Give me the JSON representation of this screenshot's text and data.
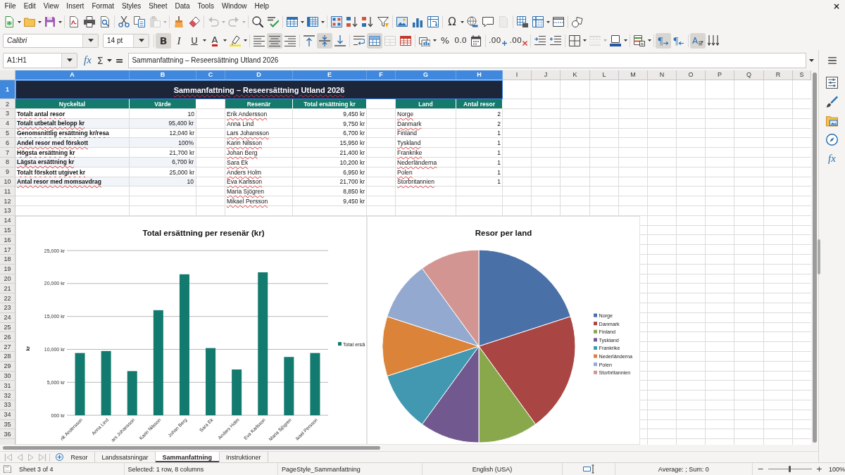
{
  "menu_bar": {
    "items": [
      "File",
      "Edit",
      "View",
      "Insert",
      "Format",
      "Styles",
      "Sheet",
      "Data",
      "Tools",
      "Window",
      "Help"
    ],
    "close": "×"
  },
  "standard_toolbar": [
    [
      {
        "kind": "new",
        "dropdown": true,
        "disabled": false
      },
      {
        "kind": "open",
        "dropdown": true,
        "disabled": false
      },
      {
        "kind": "save",
        "dropdown": true,
        "disabled": false
      }
    ],
    [
      {
        "kind": "export-pdf",
        "dropdown": false,
        "disabled": false
      },
      {
        "kind": "print",
        "dropdown": false,
        "disabled": false
      },
      {
        "kind": "print-preview",
        "dropdown": false,
        "disabled": false
      }
    ],
    [
      {
        "kind": "cut",
        "dropdown": false,
        "disabled": false
      },
      {
        "kind": "copy",
        "dropdown": false,
        "disabled": false
      },
      {
        "kind": "paste",
        "dropdown": true,
        "disabled": true
      }
    ],
    [
      {
        "kind": "clone-formatting",
        "dropdown": false,
        "disabled": false
      },
      {
        "kind": "clear-formatting",
        "dropdown": false,
        "disabled": false
      }
    ],
    [
      {
        "kind": "undo",
        "dropdown": true,
        "disabled": true
      },
      {
        "kind": "redo",
        "dropdown": true,
        "disabled": true
      }
    ],
    [
      {
        "kind": "find-replace",
        "dropdown": false,
        "disabled": false
      },
      {
        "kind": "spelling",
        "dropdown": false,
        "disabled": false
      }
    ],
    [
      {
        "kind": "row",
        "dropdown": true,
        "disabled": false
      },
      {
        "kind": "column",
        "dropdown": true,
        "disabled": false
      }
    ],
    [
      {
        "kind": "sort",
        "dropdown": false,
        "disabled": false
      },
      {
        "kind": "sort-ascending",
        "dropdown": false,
        "disabled": false
      },
      {
        "kind": "sort-descending",
        "dropdown": false,
        "disabled": false
      },
      {
        "kind": "autofilter",
        "dropdown": false,
        "disabled": false
      }
    ],
    [
      {
        "kind": "image",
        "dropdown": false,
        "disabled": false
      },
      {
        "kind": "chart",
        "dropdown": false,
        "disabled": false
      },
      {
        "kind": "pivot-table",
        "dropdown": false,
        "disabled": false
      }
    ],
    [
      {
        "kind": "special-character",
        "glyph": "Ω",
        "dropdown": true,
        "disabled": false
      },
      {
        "kind": "hyperlink",
        "dropdown": false,
        "disabled": false
      },
      {
        "kind": "comment",
        "dropdown": false,
        "disabled": false
      },
      {
        "kind": "headers-footers",
        "dropdown": false,
        "disabled": true
      }
    ],
    [
      {
        "kind": "print-area",
        "dropdown": false,
        "disabled": false
      },
      {
        "kind": "freeze",
        "dropdown": true,
        "disabled": false
      },
      {
        "kind": "split-window",
        "dropdown": false,
        "disabled": false
      }
    ],
    [
      {
        "kind": "draw-functions",
        "dropdown": false,
        "disabled": false
      }
    ]
  ],
  "formatting_toolbar": {
    "font_name": "Calibri",
    "font_size": "14 pt",
    "groups": [
      [
        {
          "kind": "bold",
          "glyph": "B",
          "dropdown": false,
          "on": true,
          "disabled": false
        },
        {
          "kind": "italic",
          "glyph": "I",
          "dropdown": false,
          "on": false,
          "disabled": false
        },
        {
          "kind": "underline",
          "glyph": "U",
          "dropdown": true,
          "on": false,
          "disabled": false
        },
        {
          "kind": "font-color",
          "glyph": "A",
          "dropdown": true,
          "on": false,
          "disabled": false
        },
        {
          "kind": "highlight",
          "dropdown": true,
          "on": false,
          "disabled": false
        }
      ],
      [
        {
          "kind": "align-left",
          "dropdown": false,
          "on": false,
          "disabled": false
        },
        {
          "kind": "align-center",
          "dropdown": false,
          "on": true,
          "disabled": false
        },
        {
          "kind": "align-right",
          "dropdown": false,
          "on": false,
          "disabled": false
        }
      ],
      [
        {
          "kind": "align-top",
          "dropdown": false,
          "on": false,
          "disabled": false
        },
        {
          "kind": "align-middle",
          "dropdown": false,
          "on": true,
          "disabled": false
        },
        {
          "kind": "align-bottom",
          "dropdown": false,
          "on": false,
          "disabled": false
        }
      ],
      [
        {
          "kind": "wrap",
          "dropdown": false,
          "on": false,
          "disabled": false
        },
        {
          "kind": "merge-center",
          "dropdown": false,
          "on": true,
          "disabled": false
        },
        {
          "kind": "merge",
          "dropdown": false,
          "on": false,
          "disabled": true
        },
        {
          "kind": "unmerge",
          "dropdown": false,
          "on": false,
          "disabled": false
        }
      ],
      [
        {
          "kind": "currency-format",
          "dropdown": true,
          "on": false,
          "disabled": false
        },
        {
          "kind": "percent",
          "glyph": "%",
          "dropdown": false,
          "on": false,
          "disabled": false
        },
        {
          "kind": "standard-format",
          "glyph": "0.0",
          "dropdown": false,
          "on": false,
          "disabled": false
        },
        {
          "kind": "date-format",
          "dropdown": false,
          "on": false,
          "disabled": false
        }
      ],
      [
        {
          "kind": "add-decimal",
          "glyph": ".00",
          "dropdown": false,
          "on": false,
          "disabled": false
        },
        {
          "kind": "delete-decimal",
          "glyph": ".00",
          "dropdown": false,
          "on": false,
          "disabled": false
        }
      ],
      [
        {
          "kind": "indent-increase",
          "dropdown": false,
          "on": false,
          "disabled": false
        },
        {
          "kind": "indent-decrease",
          "dropdown": false,
          "on": false,
          "disabled": false
        }
      ],
      [
        {
          "kind": "borders",
          "dropdown": true,
          "on": false,
          "disabled": false
        },
        {
          "kind": "border-style",
          "dropdown": true,
          "on": false,
          "disabled": true
        },
        {
          "kind": "border-color",
          "dropdown": true,
          "on": false,
          "disabled": false
        }
      ],
      [
        {
          "kind": "conditional",
          "dropdown": true,
          "on": false,
          "disabled": false
        }
      ],
      [
        {
          "kind": "left-to-right",
          "glyph": "¶",
          "dropdown": false,
          "on": true,
          "disabled": false
        },
        {
          "kind": "right-to-left",
          "glyph": "¶",
          "dropdown": false,
          "on": false,
          "disabled": false
        }
      ],
      [
        {
          "kind": "text-ltr",
          "glyph": "A",
          "dropdown": false,
          "on": true,
          "disabled": false
        },
        {
          "kind": "vertical-text",
          "dropdown": false,
          "on": false,
          "disabled": false
        }
      ]
    ]
  },
  "formula_bar": {
    "name_box": "A1:H1",
    "function_wizard": "fx",
    "sum": "Σ",
    "equals": "=",
    "content": "Sammanfattning – Reseersättning Utland 2026"
  },
  "sidebar": {
    "functions_deck": "fx"
  },
  "sheet": {
    "columns": [
      {
        "label": "A",
        "selected": true
      },
      {
        "label": "B",
        "selected": true
      },
      {
        "label": "C",
        "selected": true
      },
      {
        "label": "D",
        "selected": true
      },
      {
        "label": "E",
        "selected": true
      },
      {
        "label": "F",
        "selected": true
      },
      {
        "label": "G",
        "selected": true
      },
      {
        "label": "H",
        "selected": true
      },
      {
        "label": "I",
        "selected": false
      },
      {
        "label": "J",
        "selected": false
      },
      {
        "label": "K",
        "selected": false
      },
      {
        "label": "L",
        "selected": false
      },
      {
        "label": "M",
        "selected": false
      },
      {
        "label": "N",
        "selected": false
      },
      {
        "label": "O",
        "selected": false
      },
      {
        "label": "P",
        "selected": false
      },
      {
        "label": "Q",
        "selected": false
      },
      {
        "label": "R",
        "selected": false
      },
      {
        "label": "S",
        "selected": false
      }
    ],
    "rows": [
      {
        "label": "1",
        "selected": true
      },
      {
        "label": "2",
        "selected": false
      },
      {
        "label": "3",
        "selected": false
      },
      {
        "label": "4",
        "selected": false
      },
      {
        "label": "5",
        "selected": false
      },
      {
        "label": "6",
        "selected": false
      },
      {
        "label": "7",
        "selected": false
      },
      {
        "label": "8",
        "selected": false
      },
      {
        "label": "9",
        "selected": false
      },
      {
        "label": "10",
        "selected": false
      },
      {
        "label": "11",
        "selected": false
      },
      {
        "label": "12",
        "selected": false
      },
      {
        "label": "13",
        "selected": false
      },
      {
        "label": "14",
        "selected": false
      },
      {
        "label": "15",
        "selected": false
      },
      {
        "label": "16",
        "selected": false
      },
      {
        "label": "17",
        "selected": false
      },
      {
        "label": "18",
        "selected": false
      },
      {
        "label": "19",
        "selected": false
      },
      {
        "label": "20",
        "selected": false
      },
      {
        "label": "21",
        "selected": false
      },
      {
        "label": "22",
        "selected": false
      },
      {
        "label": "23",
        "selected": false
      },
      {
        "label": "24",
        "selected": false
      },
      {
        "label": "25",
        "selected": false
      },
      {
        "label": "26",
        "selected": false
      },
      {
        "label": "27",
        "selected": false
      },
      {
        "label": "28",
        "selected": false
      },
      {
        "label": "29",
        "selected": false
      },
      {
        "label": "30",
        "selected": false
      },
      {
        "label": "31",
        "selected": false
      },
      {
        "label": "32",
        "selected": false
      },
      {
        "label": "33",
        "selected": false
      },
      {
        "label": "34",
        "selected": false
      },
      {
        "label": "35",
        "selected": false
      },
      {
        "label": "36",
        "selected": false
      }
    ],
    "title": {
      "text": "Sammanfattning – Reseersättning Utland 2026",
      "flagged": true
    },
    "key_figures": {
      "headers": [
        "Nyckeltal",
        "Värde"
      ],
      "rows": [
        {
          "label": "Totalt antal resor",
          "flagged": true,
          "value": "10"
        },
        {
          "label": "Totalt utbetalt belopp kr",
          "flagged": true,
          "value": "95,400 kr"
        },
        {
          "label": "Genomsnittlig ersättning kr/resa",
          "flagged": true,
          "value": "12,040 kr"
        },
        {
          "label": "Andel resor med förskott",
          "flagged": true,
          "value": "100%"
        },
        {
          "label": "Högsta ersättning kr",
          "flagged": true,
          "value": "21,700 kr"
        },
        {
          "label": "Lägsta ersättning kr",
          "flagged": true,
          "value": "6,700 kr"
        },
        {
          "label": "Totalt förskott utgivet kr",
          "flagged": true,
          "value": "25,000 kr"
        },
        {
          "label": "Antal resor med momsavdrag",
          "flagged": true,
          "value": "10"
        }
      ]
    },
    "travelers": {
      "headers": [
        "Resenär",
        "Total ersättning kr"
      ],
      "rows": [
        {
          "name": "Erik Andersson",
          "flagged": true,
          "total": "9,450 kr"
        },
        {
          "name": "Anna Lind",
          "flagged": false,
          "total": "9,750 kr"
        },
        {
          "name": "Lars Johansson",
          "flagged": true,
          "total": "6,700 kr"
        },
        {
          "name": "Karin Nilsson",
          "flagged": true,
          "total": "15,950 kr"
        },
        {
          "name": "Johan Berg",
          "flagged": true,
          "total": "21,400 kr"
        },
        {
          "name": "Sara Ek",
          "flagged": true,
          "total": "10,200 kr"
        },
        {
          "name": "Anders Holm",
          "flagged": true,
          "total": "6,950 kr"
        },
        {
          "name": "Eva Karlsson",
          "flagged": true,
          "total": "21,700 kr"
        },
        {
          "name": "Maria Sjögren",
          "flagged": true,
          "total": "8,850 kr"
        },
        {
          "name": "Mikael Persson",
          "flagged": true,
          "total": "9,450 kr"
        }
      ]
    },
    "countries": {
      "headers": [
        "Land",
        "Antal resor"
      ],
      "rows": [
        {
          "country": "Norge",
          "flagged": true,
          "trips": "2"
        },
        {
          "country": "Danmark",
          "flagged": true,
          "trips": "2"
        },
        {
          "country": "Finland",
          "flagged": false,
          "trips": "1"
        },
        {
          "country": "Tyskland",
          "flagged": true,
          "trips": "1"
        },
        {
          "country": "Frankrike",
          "flagged": true,
          "trips": "1"
        },
        {
          "country": "Nederländerna",
          "flagged": true,
          "trips": "1"
        },
        {
          "country": "Polen",
          "flagged": true,
          "trips": "1"
        },
        {
          "country": "Storbritannien",
          "flagged": true,
          "trips": "1"
        }
      ]
    },
    "bar_chart": {
      "chart_data": {
        "type": "bar",
        "title": "Total ersättning per resenär (kr)",
        "ylabel": "kr",
        "categories": [
          "rik Andersson",
          "Anna Lind",
          "ars Johansson",
          "Karin Nilsson",
          "Johan Berg",
          "Sara Ek",
          "Anders Holm",
          "Eva Karlsson",
          "Maria Sjögren",
          "ikael Persson"
        ],
        "series": [
          {
            "name": "Total ersä",
            "color": "#127a6e",
            "values": [
              9450,
              9750,
              6700,
              15950,
              21400,
              10200,
              6950,
              21700,
              8850,
              9450
            ]
          }
        ],
        "ylim": [
          0,
          25000
        ],
        "yticks": [
          {
            "value": 0,
            "label": "000 kr"
          },
          {
            "value": 5000,
            "label": "5,000 kr"
          },
          {
            "value": 10000,
            "label": "10,000 kr"
          },
          {
            "value": 15000,
            "label": "15,000 kr"
          },
          {
            "value": 20000,
            "label": "20,000 kr"
          },
          {
            "value": 25000,
            "label": "25,000 kr"
          }
        ],
        "grid": true,
        "legend": "right"
      }
    },
    "pie_chart": {
      "chart_data": {
        "type": "pie",
        "title": "Resor per land",
        "categories": [
          "Norge",
          "Danmark",
          "Finland",
          "Tyskland",
          "Frankrike",
          "Nederländerna",
          "Polen",
          "Storbritannien"
        ],
        "values": [
          20,
          20,
          10,
          10,
          10,
          10,
          10,
          10
        ],
        "colors": [
          "#4a70a8",
          "#a94543",
          "#89a84c",
          "#71588f",
          "#4298b1",
          "#db8339",
          "#93a9cf",
          "#d29592"
        ],
        "legend": "right"
      }
    }
  },
  "sheet_tabs": {
    "navigation": [
      {
        "kind": "first",
        "disabled": true
      },
      {
        "kind": "previous",
        "disabled": true
      },
      {
        "kind": "next",
        "disabled": true
      },
      {
        "kind": "last",
        "disabled": true
      }
    ],
    "tabs": [
      {
        "label": "Resor",
        "selected": false
      },
      {
        "label": "Landssatsningar",
        "selected": false
      },
      {
        "label": "Sammanfattning",
        "selected": true
      },
      {
        "label": "Instruktioner",
        "selected": false
      }
    ]
  },
  "status_bar": {
    "sheet_position": "Sheet 3 of 4",
    "selection": "Selected: 1 row, 8 columns",
    "page_style": "PageStyle_Sammanfattning",
    "language": "English (USA)",
    "summary": "Average: ; Sum: 0",
    "zoom": {
      "out": "−",
      "in": "+",
      "level": 0.5,
      "reading": "100%"
    }
  }
}
